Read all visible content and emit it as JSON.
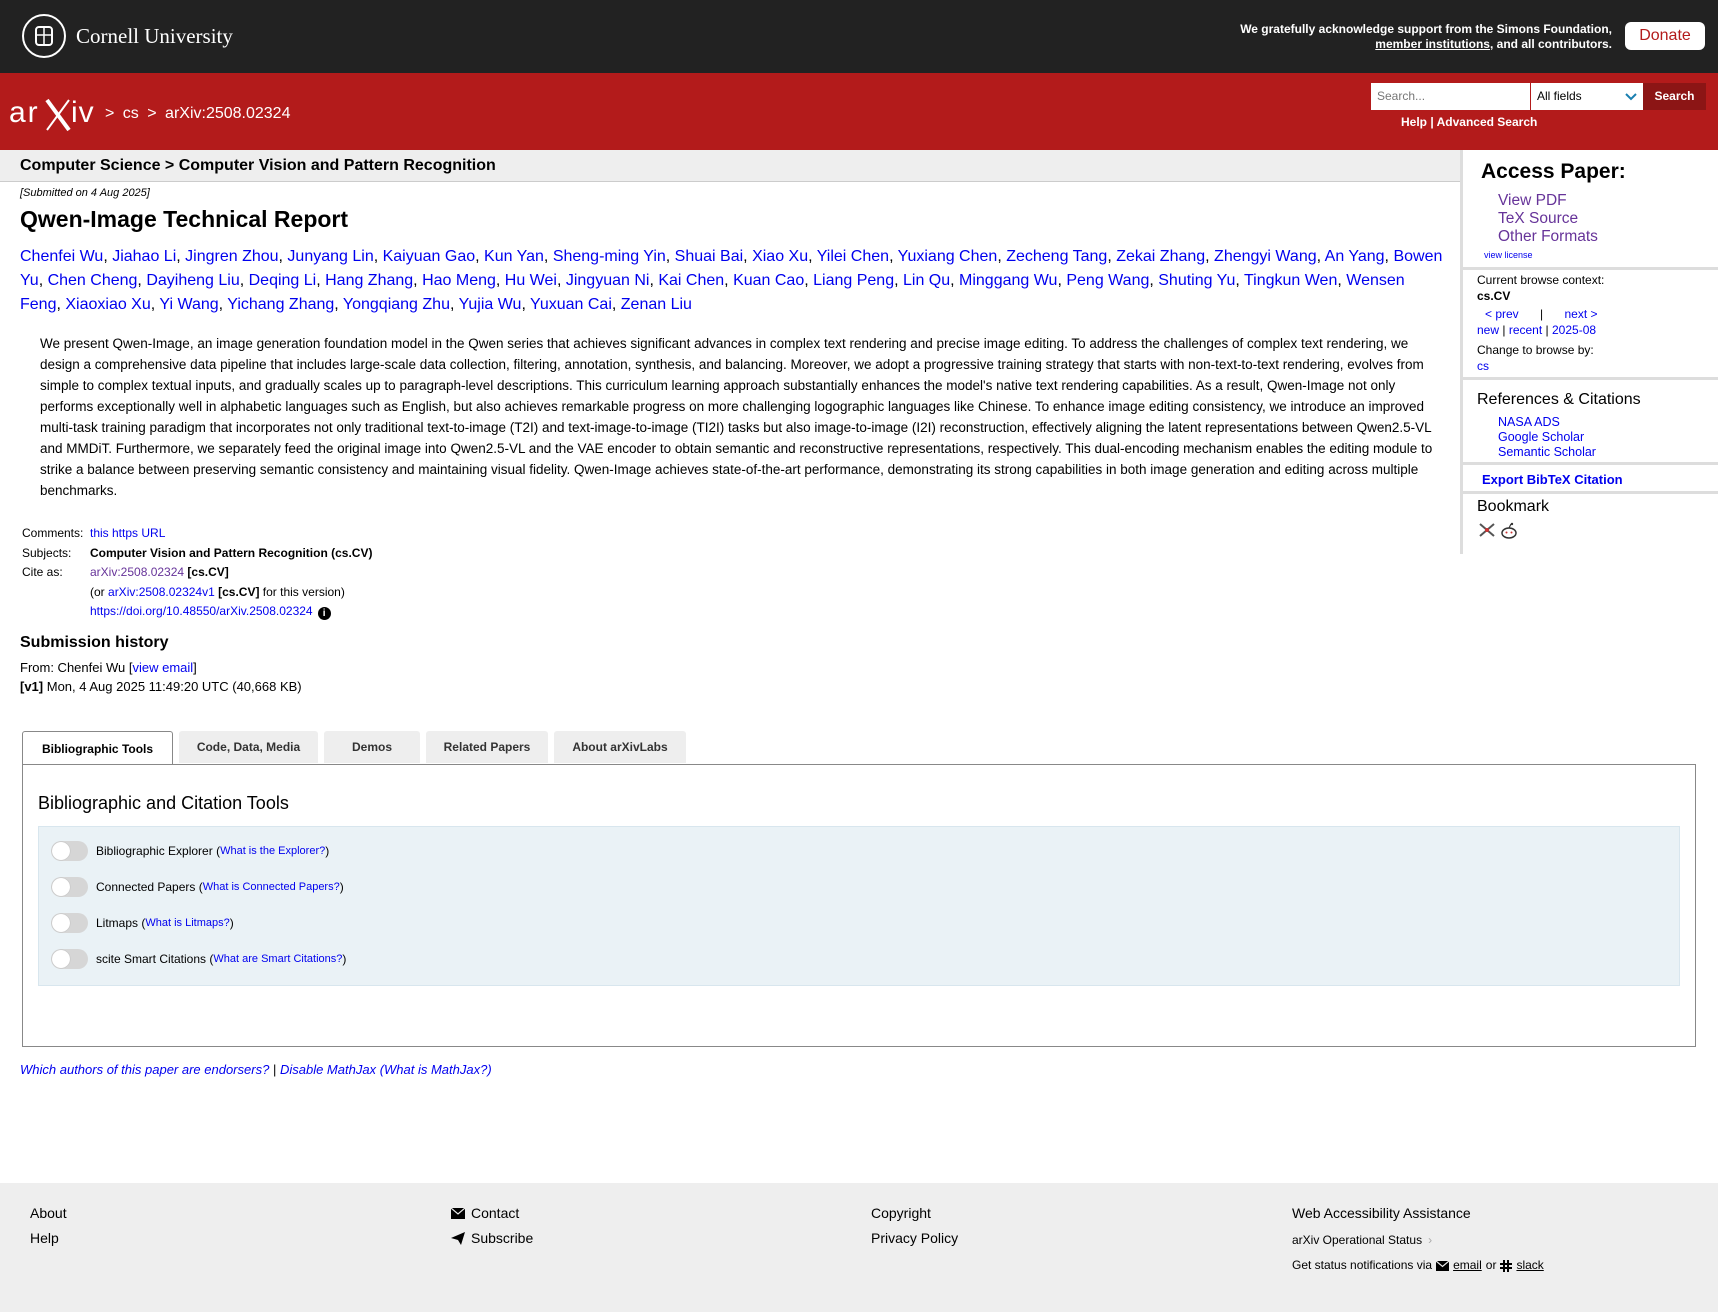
{
  "top_bar": {
    "university": "Cornell University",
    "support_text_1": "We gratefully acknowledge support from the Simons Foundation,",
    "support_link": "member institutions",
    "support_text_2": ", and all contributors.",
    "donate_label": "Donate"
  },
  "header": {
    "logo_text": "arXiv",
    "breadcrumb": [
      ">",
      "cs",
      ">",
      "arXiv:2508.02324"
    ],
    "search_placeholder": "Search...",
    "field_selected": "All fields",
    "search_button": "Search",
    "help_link": "Help",
    "separator": "|",
    "advanced_link": "Advanced Search"
  },
  "subject_bar": "Computer Science > Computer Vision and Pattern Recognition",
  "paper": {
    "dateline": "[Submitted on 4 Aug 2025]",
    "title": "Qwen-Image Technical Report",
    "authors": [
      "Chenfei Wu",
      "Jiahao Li",
      "Jingren Zhou",
      "Junyang Lin",
      "Kaiyuan Gao",
      "Kun Yan",
      "Sheng-ming Yin",
      "Shuai Bai",
      "Xiao Xu",
      "Yilei Chen",
      "Yuxiang Chen",
      "Zecheng Tang",
      "Zekai Zhang",
      "Zhengyi Wang",
      "An Yang",
      "Bowen Yu",
      "Chen Cheng",
      "Dayiheng Liu",
      "Deqing Li",
      "Hang Zhang",
      "Hao Meng",
      "Hu Wei",
      "Jingyuan Ni",
      "Kai Chen",
      "Kuan Cao",
      "Liang Peng",
      "Lin Qu",
      "Minggang Wu",
      "Peng Wang",
      "Shuting Yu",
      "Tingkun Wen",
      "Wensen Feng",
      "Xiaoxiao Xu",
      "Yi Wang",
      "Yichang Zhang",
      "Yongqiang Zhu",
      "Yujia Wu",
      "Yuxuan Cai",
      "Zenan Liu"
    ],
    "abstract": "We present Qwen-Image, an image generation foundation model in the Qwen series that achieves significant advances in complex text rendering and precise image editing. To address the challenges of complex text rendering, we design a comprehensive data pipeline that includes large-scale data collection, filtering, annotation, synthesis, and balancing. Moreover, we adopt a progressive training strategy that starts with non-text-to-text rendering, evolves from simple to complex textual inputs, and gradually scales up to paragraph-level descriptions. This curriculum learning approach substantially enhances the model's native text rendering capabilities. As a result, Qwen-Image not only performs exceptionally well in alphabetic languages such as English, but also achieves remarkable progress on more challenging logographic languages like Chinese. To enhance image editing consistency, we introduce an improved multi-task training paradigm that incorporates not only traditional text-to-image (T2I) and text-image-to-image (TI2I) tasks but also image-to-image (I2I) reconstruction, effectively aligning the latent representations between Qwen2.5-VL and MMDiT. Furthermore, we separately feed the original image into Qwen2.5-VL and the VAE encoder to obtain semantic and reconstructive representations, respectively. This dual-encoding mechanism enables the editing module to strike a balance between preserving semantic consistency and maintaining visual fidelity. Qwen-Image achieves state-of-the-art performance, demonstrating its strong capabilities in both image generation and editing across multiple benchmarks."
  },
  "meta": {
    "comments_label": "Comments:",
    "comments_value": "this https URL",
    "subjects_label": "Subjects:",
    "subjects_value": "Computer Vision and Pattern Recognition (cs.CV)",
    "cite_label": "Cite as:",
    "cite_id": "arXiv:2508.02324",
    "cite_cat": "[cs.CV]",
    "or_prefix": "(or",
    "cite_v1": "arXiv:2508.02324v1",
    "cite_v1_cat": "[cs.CV]",
    "or_suffix": "for this version)",
    "doi": "https://doi.org/10.48550/arXiv.2508.02324",
    "info_glyph": "i"
  },
  "history": {
    "title": "Submission history",
    "from_prefix": "From: Chenfei Wu [",
    "view_email": "view email",
    "from_suffix": "]",
    "v1_label": "[v1]",
    "v1_text": "Mon, 4 Aug 2025 11:49:20 UTC (40,668 KB)"
  },
  "tabs": [
    "Bibliographic Tools",
    "Code, Data, Media",
    "Demos",
    "Related Papers",
    "About arXivLabs"
  ],
  "panel": {
    "title": "Bibliographic and Citation Tools",
    "tools": [
      {
        "label": "Bibliographic Explorer",
        "help": "What is the Explorer?"
      },
      {
        "label": "Connected Papers",
        "help": "What is Connected Papers?"
      },
      {
        "label": "Litmaps",
        "help": "What is Litmaps?"
      },
      {
        "label": "scite Smart Citations",
        "help": "What are Smart Citations?"
      }
    ]
  },
  "endorsers": {
    "endorsers_link": "Which authors of this paper are endorsers?",
    "sep": "|",
    "mathjax_link": "Disable MathJax",
    "what_mathjax": "(What is MathJax?)"
  },
  "sidebar": {
    "access_title": "Access Paper:",
    "access_links": [
      "View PDF",
      "TeX Source",
      "Other Formats"
    ],
    "view_license": "view license",
    "context_label": "Current browse context:",
    "context_code": "cs.CV",
    "prev": "< prev",
    "nav_sep": "|",
    "next": "next >",
    "new": "new",
    "recent": "recent",
    "month": "2025-08",
    "change_label": "Change to browse by:",
    "change_cs": "cs",
    "refs_title": "References & Citations",
    "refs_links": [
      "NASA ADS",
      "Google Scholar",
      "Semantic Scholar"
    ],
    "bibtex": "Export BibTeX Citation",
    "bookmark_title": "Bookmark"
  },
  "footer": {
    "about": "About",
    "help": "Help",
    "contact": "Contact",
    "subscribe": "Subscribe",
    "copyright": "Copyright",
    "privacy": "Privacy Policy",
    "accessibility": "Web Accessibility Assistance",
    "status": "arXiv Operational Status",
    "status_chevron": "›",
    "notify_prefix": "Get status notifications via",
    "email": "email",
    "or": "or",
    "slack": "slack"
  },
  "colors": {
    "arxiv_red": "#b31b1b",
    "cornell_bar": "#222222",
    "link_blue": "#0000ee",
    "visited_purple": "#663399"
  }
}
